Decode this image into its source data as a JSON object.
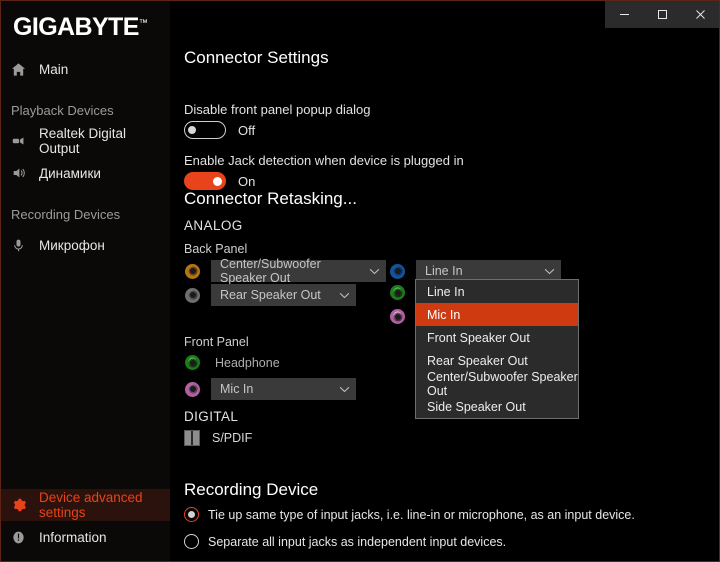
{
  "window": {
    "brand": "GIGABYTE",
    "brand_tm": "™",
    "buttons": {
      "minimize": "minimize",
      "maximize": "maximize",
      "close": "close"
    }
  },
  "sidebar": {
    "items": [
      {
        "label": "Main",
        "icon": "home-icon",
        "type": "item",
        "active": false
      },
      {
        "label": "Playback Devices",
        "icon": "",
        "type": "header",
        "active": false
      },
      {
        "label": "Realtek Digital Output",
        "icon": "digital-output-icon",
        "type": "item",
        "active": false
      },
      {
        "label": "Динамики",
        "icon": "speaker-icon",
        "type": "item",
        "active": false
      },
      {
        "label": "Recording Devices",
        "icon": "",
        "type": "header",
        "active": false
      },
      {
        "label": "Микрофон",
        "icon": "microphone-icon",
        "type": "item",
        "active": false
      }
    ],
    "bottom_items": [
      {
        "label": "Device advanced settings",
        "icon": "gear-icon",
        "active": true
      },
      {
        "label": "Information",
        "icon": "info-icon",
        "active": false
      }
    ],
    "accent": "#e8431a",
    "active_bg": "#2c120c"
  },
  "main": {
    "connector_settings": {
      "title": "Connector Settings",
      "options": [
        {
          "label": "Disable front panel popup dialog",
          "state": "Off",
          "on": false
        },
        {
          "label": "Enable Jack detection when device is plugged in",
          "state": "On",
          "on": true
        }
      ]
    },
    "connector_retasking": {
      "title": "Connector Retasking...",
      "analog_label": "ANALOG",
      "back_panel_label": "Back Panel",
      "front_panel_label": "Front Panel",
      "digital_label": "DIGITAL",
      "spdif_label": "S/PDIF",
      "back_panel_left": [
        {
          "color": "#d08a1e",
          "value": "Center/Subwoofer Speaker Out",
          "combo": true
        },
        {
          "color": "#8f8f8f",
          "value": "Rear Speaker Out",
          "combo": true
        }
      ],
      "back_panel_right": [
        {
          "color": "#1f6fc4",
          "value": "Line In",
          "combo": true,
          "open": true
        },
        {
          "color": "#3aaa35",
          "value": "",
          "combo": false
        },
        {
          "color": "#e08ad0",
          "value": "",
          "combo": false
        }
      ],
      "front_panel": [
        {
          "color": "#3aaa35",
          "value": "Headphone",
          "combo": false
        },
        {
          "color": "#e08ad0",
          "value": "Mic In",
          "combo": true
        }
      ],
      "dropdown_options": [
        {
          "label": "Line In",
          "selected": false
        },
        {
          "label": "Mic In",
          "selected": true
        },
        {
          "label": "Front Speaker Out",
          "selected": false
        },
        {
          "label": "Rear Speaker Out",
          "selected": false
        },
        {
          "label": "Center/Subwoofer Speaker Out",
          "selected": false
        },
        {
          "label": "Side Speaker Out",
          "selected": false
        }
      ]
    },
    "recording_device": {
      "title": "Recording Device",
      "options": [
        {
          "label": "Tie up same type of input jacks, i.e. line-in or microphone, as an input device.",
          "checked": true
        },
        {
          "label": "Separate all input jacks as independent input devices.",
          "checked": false
        }
      ]
    }
  }
}
